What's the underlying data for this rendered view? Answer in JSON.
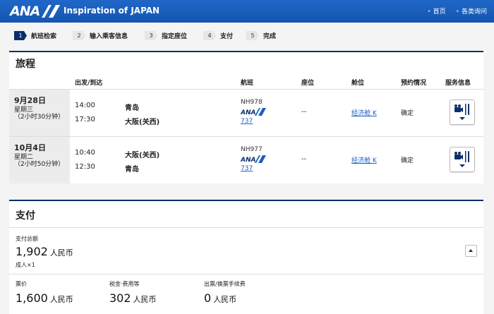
{
  "header": {
    "logo": "ANA",
    "tagline": "Inspiration of JAPAN",
    "links": [
      "首页",
      "各类询问"
    ],
    "brand_color": "#1a5fbf"
  },
  "steps": [
    {
      "num": "1",
      "label": "航班检索",
      "active": true
    },
    {
      "num": "2",
      "label": "输入乘客信息",
      "active": false
    },
    {
      "num": "3",
      "label": "指定座位",
      "active": false
    },
    {
      "num": "4",
      "label": "支付",
      "active": false
    },
    {
      "num": "5",
      "label": "完成",
      "active": false
    }
  ],
  "itinerary": {
    "title": "旅程",
    "columns": {
      "depart_arrive": "出发/到达",
      "flight": "航班",
      "seat": "座位",
      "cabin": "舱位",
      "status": "预约情况",
      "service": "服务信息"
    },
    "rows": [
      {
        "date": "9月28日",
        "weekday": "星期三",
        "duration": "（2小时30分钟）",
        "dep_time": "14:00",
        "dep_city": "青岛",
        "arr_time": "17:30",
        "arr_city": "大阪(关西)",
        "flight_no": "NH978",
        "airline": "ANA",
        "aircraft": "737",
        "seat": "--",
        "cabin": "经济舱 K",
        "status": "确定"
      },
      {
        "date": "10月4日",
        "weekday": "星期二",
        "duration": "（2小时50分钟）",
        "dep_time": "10:40",
        "dep_city": "大阪(关西)",
        "arr_time": "12:30",
        "arr_city": "青岛",
        "flight_no": "NH977",
        "airline": "ANA",
        "aircraft": "737",
        "seat": "--",
        "cabin": "经济舱 K",
        "status": "确定"
      }
    ]
  },
  "payment": {
    "title": "支付",
    "total_label": "支付总额",
    "total_amount": "1,902",
    "currency": "人民币",
    "passengers": "成人×1",
    "fare_label": "票价",
    "fare_amount": "1,600",
    "tax_label": "税金·费用等",
    "tax_amount": "302",
    "fee_label": "出票/换票手续费",
    "fee_amount": "0"
  }
}
